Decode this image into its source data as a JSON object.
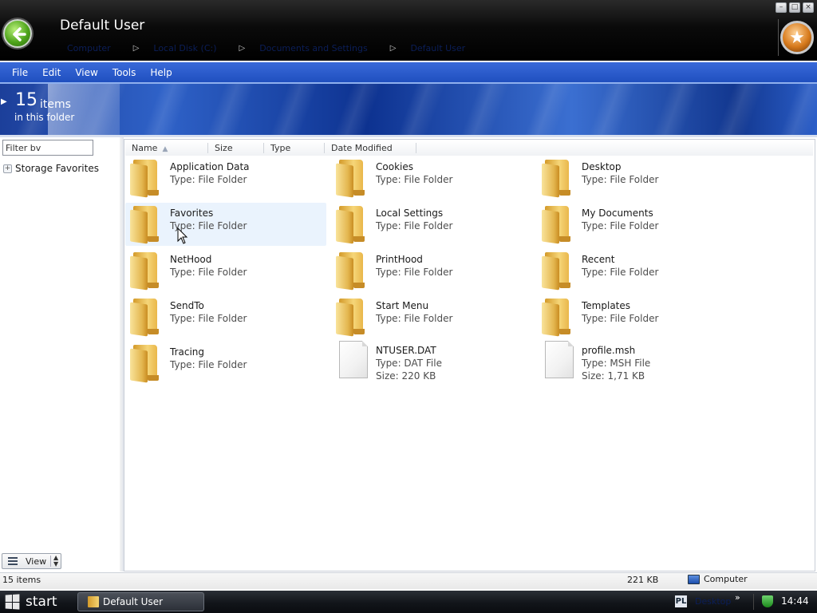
{
  "window": {
    "title": "Default User",
    "breadcrumb": [
      "Computer",
      "Local Disk (C:)",
      "Documents and Settings",
      "Default User"
    ]
  },
  "menu": [
    "File",
    "Edit",
    "View",
    "Tools",
    "Help"
  ],
  "header": {
    "count": "15",
    "count_word": "items",
    "subtitle": "in this folder"
  },
  "left_pane": {
    "filter_value": "Filter bv",
    "favorites_label": "Storage Favorites",
    "view_label": "View"
  },
  "columns": [
    "Name",
    "Size",
    "Type",
    "Date Modified"
  ],
  "items": [
    {
      "name": "Application Data",
      "type": "Type: File Folder",
      "kind": "folder"
    },
    {
      "name": "Cookies",
      "type": "Type: File Folder",
      "kind": "folder"
    },
    {
      "name": "Desktop",
      "type": "Type: File Folder",
      "kind": "folder"
    },
    {
      "name": "Favorites",
      "type": "Type: File Folder",
      "kind": "folder"
    },
    {
      "name": "Local Settings",
      "type": "Type: File Folder",
      "kind": "folder"
    },
    {
      "name": "My Documents",
      "type": "Type: File Folder",
      "kind": "folder"
    },
    {
      "name": "NetHood",
      "type": "Type: File Folder",
      "kind": "folder"
    },
    {
      "name": "PrintHood",
      "type": "Type: File Folder",
      "kind": "folder"
    },
    {
      "name": "Recent",
      "type": "Type: File Folder",
      "kind": "folder"
    },
    {
      "name": "SendTo",
      "type": "Type: File Folder",
      "kind": "folder"
    },
    {
      "name": "Start Menu",
      "type": "Type: File Folder",
      "kind": "folder"
    },
    {
      "name": "Templates",
      "type": "Type: File Folder",
      "kind": "folder"
    },
    {
      "name": "Tracing",
      "type": "Type: File Folder",
      "kind": "folder"
    },
    {
      "name": "NTUSER.DAT",
      "type": "Type: DAT File",
      "size": "Size: 220 KB",
      "kind": "file"
    },
    {
      "name": "profile.msh",
      "type": "Type: MSH File",
      "size": "Size: 1,71 KB",
      "kind": "file"
    }
  ],
  "status": {
    "count": "15 items",
    "size": "221 KB",
    "location": "Computer"
  },
  "taskbar": {
    "start": "start",
    "task": "Default User",
    "lang": "PL",
    "desktop": "Desktop",
    "time": "14:44"
  },
  "colors": {
    "menu_bar": "#2a5bcc",
    "hover": "#eaf3fd",
    "folder": "#e9b74a"
  }
}
